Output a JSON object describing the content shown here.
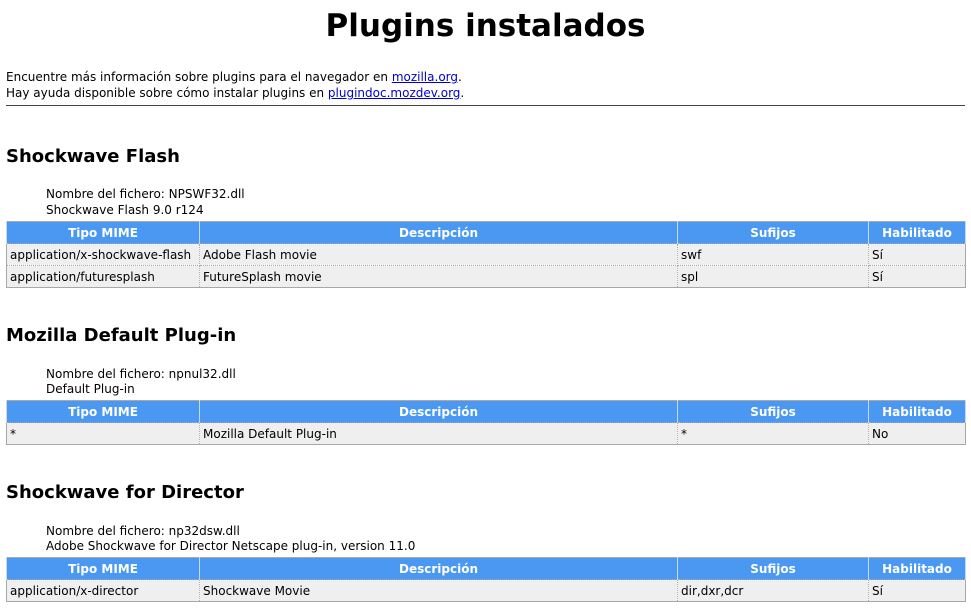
{
  "page": {
    "title": "Plugins instalados",
    "info_line1_prefix": "Encuentre más información sobre plugins para el navegador en ",
    "info_line1_link": "mozilla.org",
    "info_line1_suffix": ".",
    "info_line2_prefix": "Hay ayuda disponible sobre cómo instalar plugins en ",
    "info_line2_link": "plugindoc.mozdev.org",
    "info_line2_suffix": "."
  },
  "columns": {
    "mime": "Tipo MIME",
    "desc": "Descripción",
    "suffix": "Sufijos",
    "enabled": "Habilitado"
  },
  "plugins": [
    {
      "name": "Shockwave Flash",
      "file": "Nombre del fichero: NPSWF32.dll",
      "description": "Shockwave Flash 9.0 r124",
      "rows": [
        {
          "mime": "application/x-shockwave-flash",
          "desc": "Adobe Flash movie",
          "suffix": "swf",
          "enabled": "Sí"
        },
        {
          "mime": "application/futuresplash",
          "desc": "FutureSplash movie",
          "suffix": "spl",
          "enabled": "Sí"
        }
      ]
    },
    {
      "name": "Mozilla Default Plug-in",
      "file": "Nombre del fichero: npnul32.dll",
      "description": "Default Plug-in",
      "rows": [
        {
          "mime": "*",
          "desc": "Mozilla Default Plug-in",
          "suffix": "*",
          "enabled": "No"
        }
      ]
    },
    {
      "name": "Shockwave for Director",
      "file": "Nombre del fichero: np32dsw.dll",
      "description": "Adobe Shockwave for Director Netscape plug-in, version 11.0",
      "rows": [
        {
          "mime": "application/x-director",
          "desc": "Shockwave Movie",
          "suffix": "dir,dxr,dcr",
          "enabled": "Sí"
        }
      ]
    }
  ]
}
